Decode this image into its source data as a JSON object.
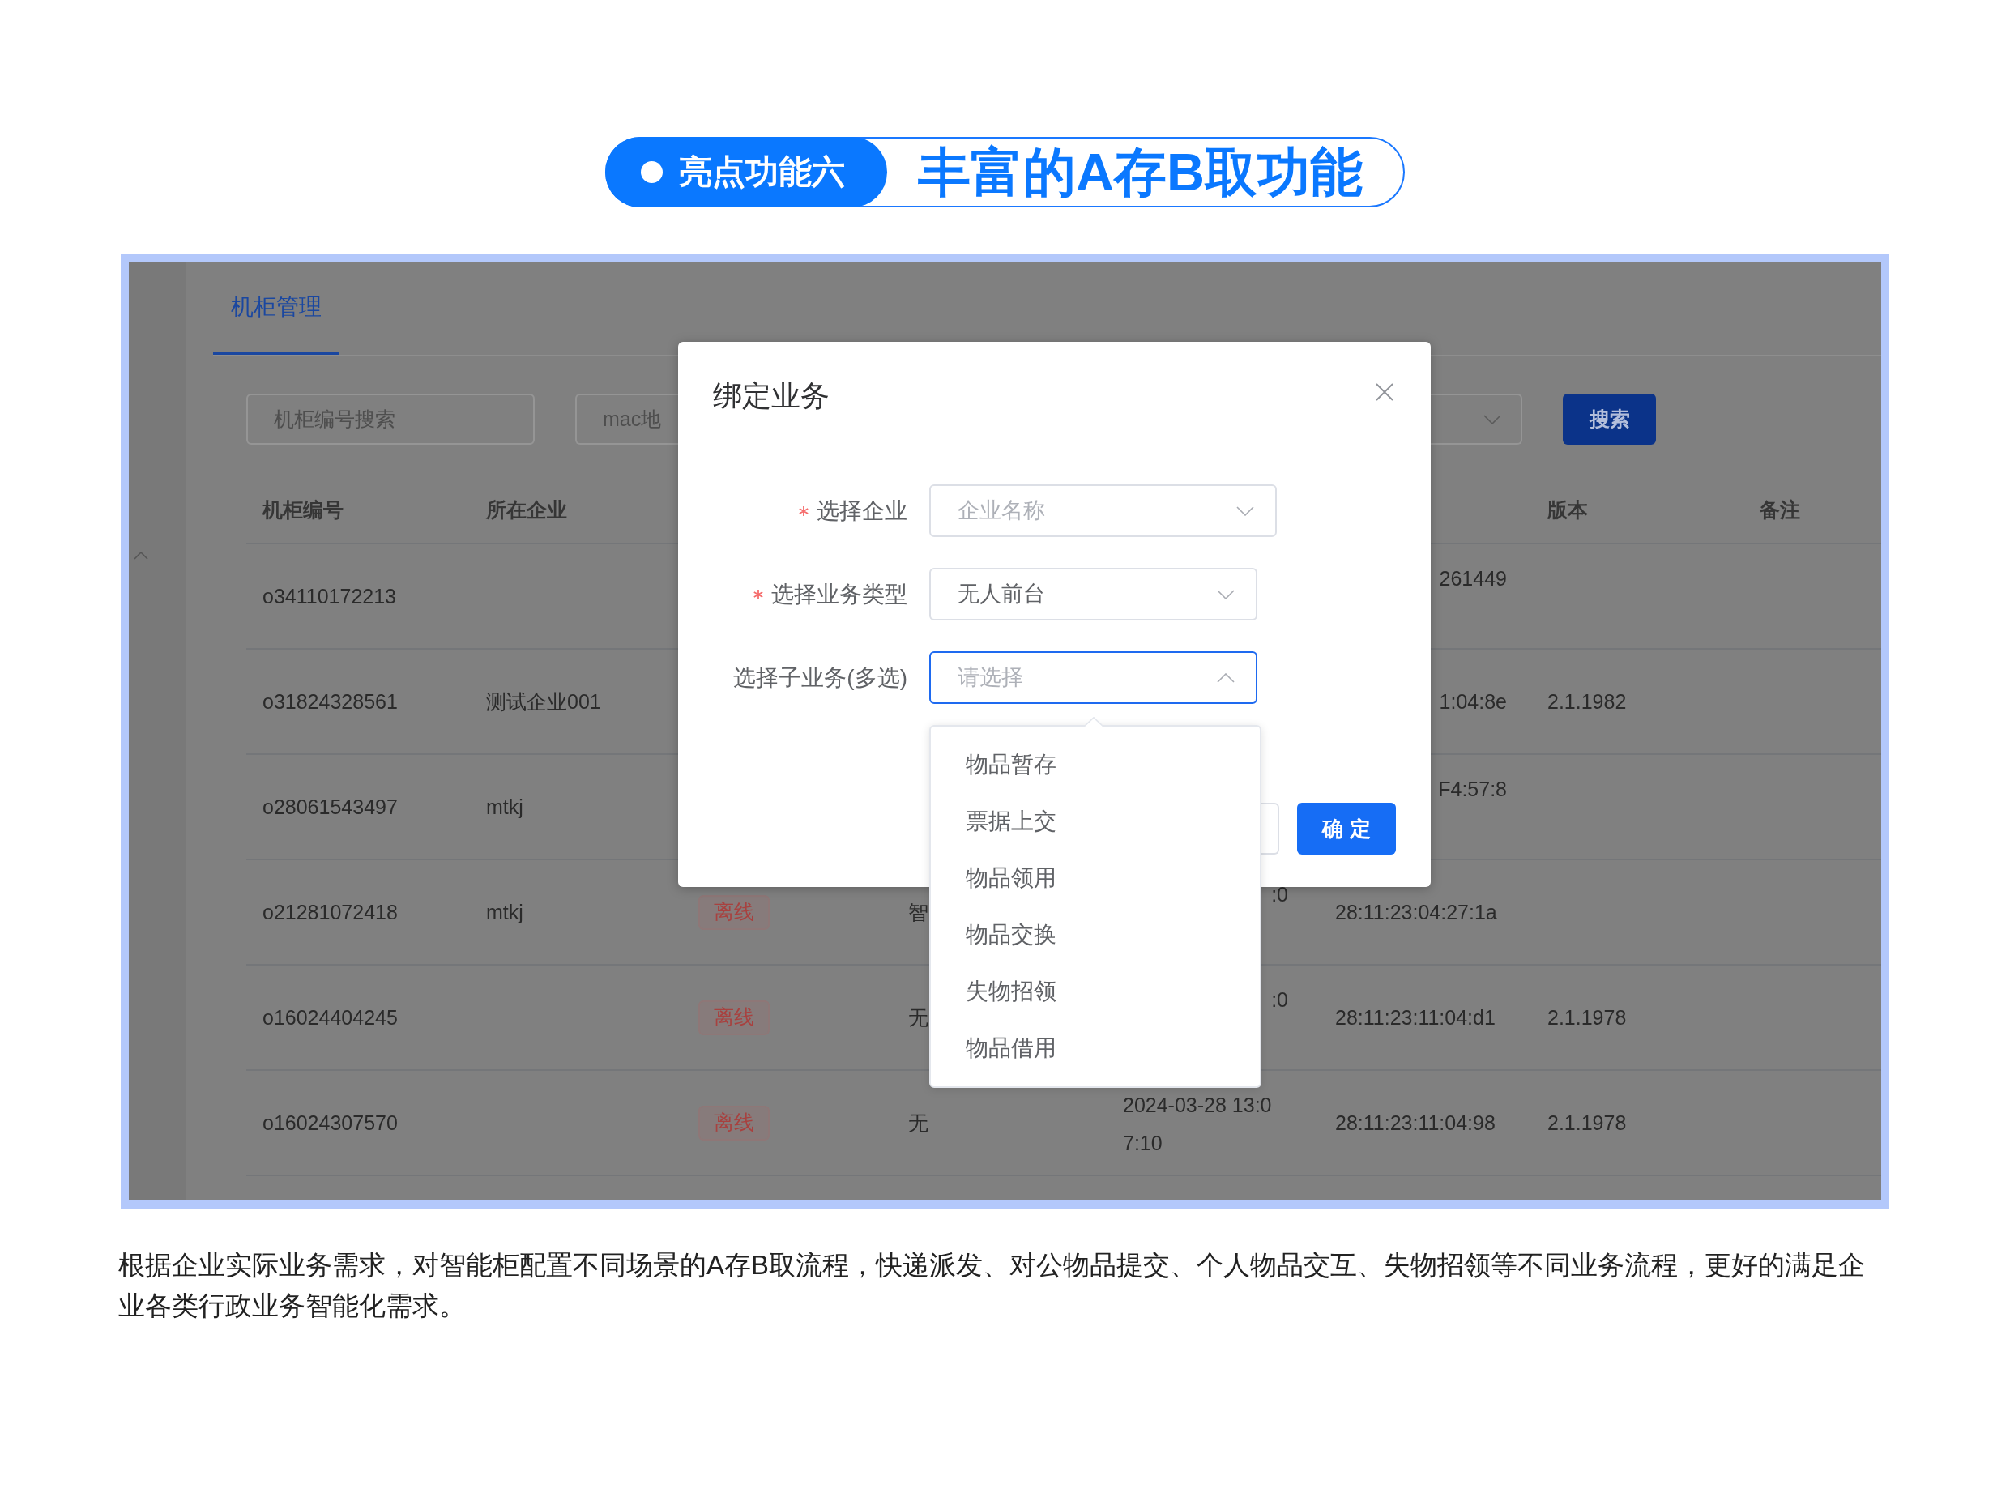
{
  "banner": {
    "badge": "亮点功能六",
    "title": "丰富的A存B取功能"
  },
  "screen": {
    "tabs": [
      {
        "label": "机柜管理",
        "selected": true
      }
    ],
    "filters": [
      {
        "kind": "input",
        "placeholder": "机柜编号搜索",
        "clipped": false
      },
      {
        "kind": "input",
        "placeholder": "mac地",
        "clipped": true
      },
      {
        "kind": "select",
        "clipped": true
      }
    ],
    "search_button": "搜索",
    "table": {
      "columns": {
        "cabinet_no": "机柜编号",
        "company": "所在企业",
        "version": "版本",
        "remarks": "备注"
      },
      "rows": [
        {
          "cabinet_no": {
            "kind": "text",
            "text": "o34110172213"
          },
          "column_6": {
            "kind": "text",
            "text": "261449",
            "wrapped": true,
            "clipped": true
          }
        },
        {
          "cabinet_no": {
            "kind": "text",
            "text": "o31824328561"
          },
          "company": {
            "kind": "text",
            "text": "测试企业001"
          },
          "column_6": {
            "kind": "text",
            "text": "1:04:8e",
            "wrapped": false,
            "clipped": true
          },
          "version": {
            "kind": "text",
            "text": "2.1.1982"
          }
        },
        {
          "cabinet_no": {
            "kind": "text",
            "text": "o28061543497"
          },
          "company": {
            "kind": "text",
            "text": "mtkj"
          },
          "column_6": {
            "kind": "text",
            "text": "F4:57:8",
            "wrapped": true,
            "clipped": true
          }
        },
        {
          "cabinet_no": {
            "kind": "text",
            "text": "o21281072418"
          },
          "company": {
            "kind": "text",
            "text": "mtkj"
          },
          "column_3": {
            "kind": "tag",
            "text": "离线"
          },
          "column_4": {
            "kind": "text",
            "text": "智"
          },
          "column_5": {
            "kind": "text",
            "text": ":0",
            "wrapped": true,
            "clipped": true
          },
          "column_6": {
            "kind": "text",
            "text": "28:11:23:04:27:1a",
            "wrapped": false,
            "clipped": false
          }
        },
        {
          "cabinet_no": {
            "kind": "text",
            "text": "o16024404245"
          },
          "column_3": {
            "kind": "tag",
            "text": "离线"
          },
          "column_4": {
            "kind": "text",
            "text": "无"
          },
          "column_5": {
            "kind": "text",
            "text": ":0",
            "wrapped": true,
            "clipped": true
          },
          "column_6": {
            "kind": "text",
            "text": "28:11:23:11:04:d1",
            "wrapped": false,
            "clipped": false
          },
          "version": {
            "kind": "text",
            "text": "2.1.1978"
          }
        },
        {
          "cabinet_no": {
            "kind": "text",
            "text": "o16024307570"
          },
          "column_3": {
            "kind": "tag",
            "text": "离线"
          },
          "column_4": {
            "kind": "text",
            "text": "无"
          },
          "column_5": {
            "kind": "text",
            "text": "2024-03-28 13:07:10",
            "wrapped": true,
            "clipped": false
          },
          "column_6": {
            "kind": "text",
            "text": "28:11:23:11:04:98",
            "wrapped": false,
            "clipped": false
          },
          "version": {
            "kind": "text",
            "text": "2.1.1978"
          }
        }
      ]
    }
  },
  "dialog": {
    "title": "绑定业务",
    "fields": [
      {
        "label": "选择企业",
        "required": true,
        "placeholder": "企业名称",
        "focused": false,
        "expanded": false
      },
      {
        "label": "选择业务类型",
        "required": true,
        "value": "无人前台",
        "focused": false,
        "expanded": false
      },
      {
        "label": "选择子业务(多选)",
        "required": false,
        "placeholder": "请选择",
        "focused": true,
        "expanded": true,
        "options": [
          {
            "label": "物品暂存",
            "selected": false
          },
          {
            "label": "票据上交",
            "selected": false
          },
          {
            "label": "物品领用",
            "selected": false
          },
          {
            "label": "物品交换",
            "selected": false
          },
          {
            "label": "失物招领",
            "selected": false
          },
          {
            "label": "物品借用",
            "selected": false
          }
        ]
      }
    ],
    "buttons": [
      {
        "kind": "default"
      },
      {
        "kind": "primary",
        "label": "确 定"
      }
    ]
  },
  "description": "根据企业实际业务需求，对智能柜配置不同场景的A存B取流程，快递派发、对公物品提交、个人物品交互、失物招领等不同业务流程，更好的满足企业各类行政业务智能化需求。"
}
